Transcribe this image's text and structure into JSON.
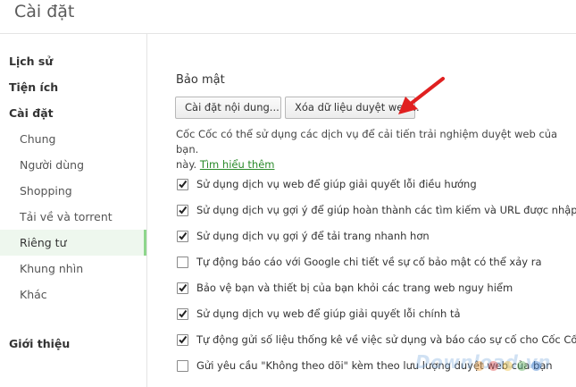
{
  "header": {
    "title": "Cài đặt"
  },
  "sidebar": {
    "items": [
      {
        "label": "Lịch sử",
        "level": "top",
        "active": false
      },
      {
        "label": "Tiện ích",
        "level": "top",
        "active": false
      },
      {
        "label": "Cài đặt",
        "level": "top",
        "active": false
      },
      {
        "label": "Chung",
        "level": "sub",
        "active": false
      },
      {
        "label": "Người dùng",
        "level": "sub",
        "active": false
      },
      {
        "label": "Shopping",
        "level": "sub",
        "active": false
      },
      {
        "label": "Tải về và torrent",
        "level": "sub",
        "active": false
      },
      {
        "label": "Riêng tư",
        "level": "sub",
        "active": true
      },
      {
        "label": "Khung nhìn",
        "level": "sub",
        "active": false
      },
      {
        "label": "Khác",
        "level": "sub",
        "active": false
      },
      {
        "label": "Giới thiệu",
        "level": "top",
        "active": false
      }
    ]
  },
  "privacy": {
    "section_title": "Bảo mật",
    "content_settings_button": "Cài đặt nội dung...",
    "clear_data_button": "Xóa dữ liệu duyệt web...",
    "description": "Cốc Cốc có thể sử dụng các dịch vụ để cải tiến trải nghiệm duyệt web của bạn.",
    "description_cont": "này.",
    "learn_more_link": "Tìm hiểu thêm",
    "options": [
      {
        "label": "Sử dụng dịch vụ web để giúp giải quyết lỗi điều hướng",
        "checked": true
      },
      {
        "label": "Sử dụng dịch vụ gợi ý để giúp hoàn thành các tìm kiếm và URL được nhập trong",
        "checked": true
      },
      {
        "label": "Sử dụng dịch vụ gợi ý để tải trang nhanh hơn",
        "checked": true
      },
      {
        "label": "Tự động báo cáo với Google chi tiết về sự cố bảo mật có thể xảy ra",
        "checked": false
      },
      {
        "label": "Bảo vệ bạn và thiết bị của bạn khỏi các trang web nguy hiểm",
        "checked": true
      },
      {
        "label": "Sử dụng dịch vụ web để giúp giải quyết lỗi chính tả",
        "checked": true
      },
      {
        "label": "Tự động gửi số liệu thống kê về việc sử dụng và báo cáo sự cố cho Cốc Cốc",
        "checked": true
      },
      {
        "label": "Gửi yêu cầu \"Không theo dõi\" kèm theo lưu lượng duyệt web của bạn",
        "checked": false
      }
    ]
  },
  "watermark": {
    "text": "Download.vn"
  },
  "colors": {
    "accent_green": "#2a8a2a",
    "active_item_bg": "#eef7ee",
    "active_item_bar": "#8ed68c",
    "annotation_arrow": "#e02020"
  }
}
